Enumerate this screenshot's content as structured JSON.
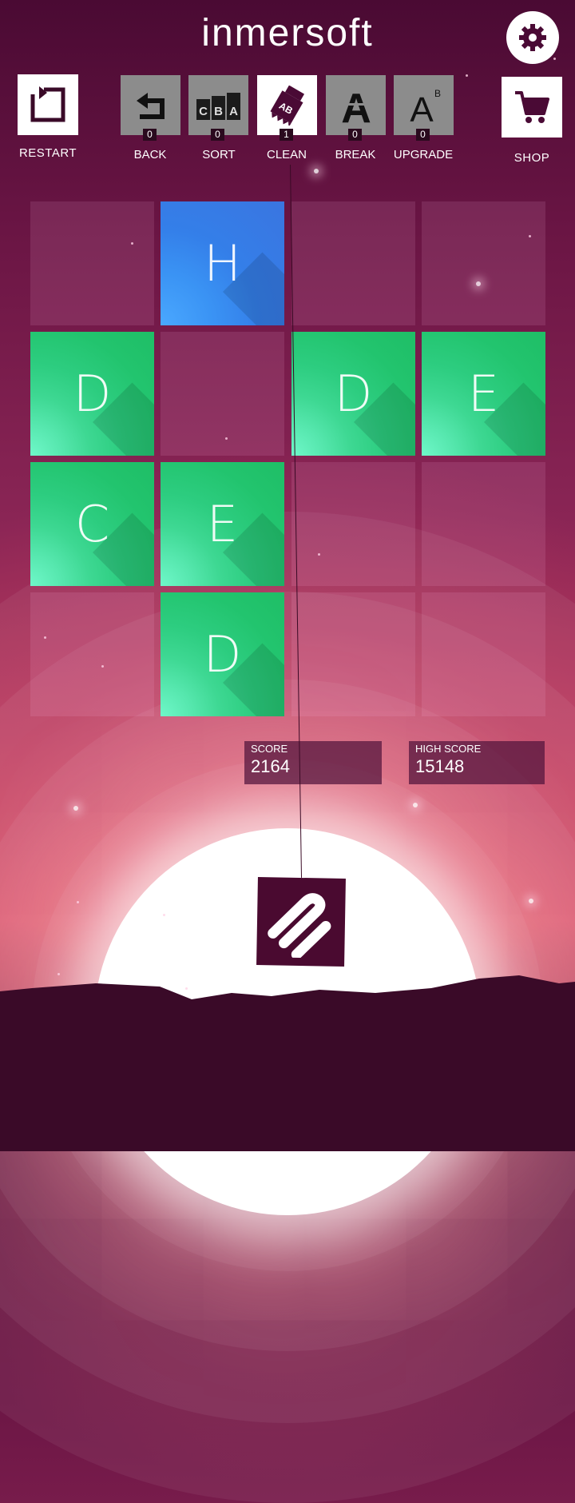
{
  "header": {
    "logo": "inmersoft"
  },
  "icons": {
    "settings": "gear-icon",
    "restart": "restart-icon",
    "shop": "cart-icon"
  },
  "left_button": {
    "label": "RESTART"
  },
  "right_button": {
    "label": "SHOP"
  },
  "powerups": [
    {
      "label": "BACK",
      "count": "0",
      "icon": "undo-arrow-icon",
      "active": false
    },
    {
      "label": "SORT",
      "count": "0",
      "icon": "sort-cba-icon",
      "icon_text": "CBA",
      "active": false
    },
    {
      "label": "CLEAN",
      "count": "1",
      "icon": "eraser-ab-icon",
      "icon_text": "AB",
      "active": true
    },
    {
      "label": "BREAK",
      "count": "0",
      "icon": "broken-a-icon",
      "icon_text": "A",
      "active": false
    },
    {
      "label": "UPGRADE",
      "count": "0",
      "icon": "upgrade-a-icon",
      "icon_text": "A",
      "icon_sup": "B",
      "active": false
    }
  ],
  "board": {
    "columns": 4,
    "rows": 4,
    "tiles": [
      {
        "row": 0,
        "col": 1,
        "letter": "H",
        "color": "blue"
      },
      {
        "row": 1,
        "col": 0,
        "letter": "D",
        "color": "green"
      },
      {
        "row": 1,
        "col": 2,
        "letter": "D",
        "color": "green"
      },
      {
        "row": 1,
        "col": 3,
        "letter": "E",
        "color": "green"
      },
      {
        "row": 2,
        "col": 0,
        "letter": "C",
        "color": "green"
      },
      {
        "row": 2,
        "col": 1,
        "letter": "E",
        "color": "green"
      },
      {
        "row": 3,
        "col": 1,
        "letter": "D",
        "color": "green"
      }
    ]
  },
  "score": {
    "label": "SCORE",
    "value": "2164"
  },
  "high_score": {
    "label": "HIGH SCORE",
    "value": "15148"
  },
  "next_tile": {
    "icon": "z-letter-icon"
  },
  "colors": {
    "tile_green": "#22c46e",
    "tile_blue": "#3a85f0",
    "dark": "#3a0a28",
    "sun": "#ffffff"
  }
}
